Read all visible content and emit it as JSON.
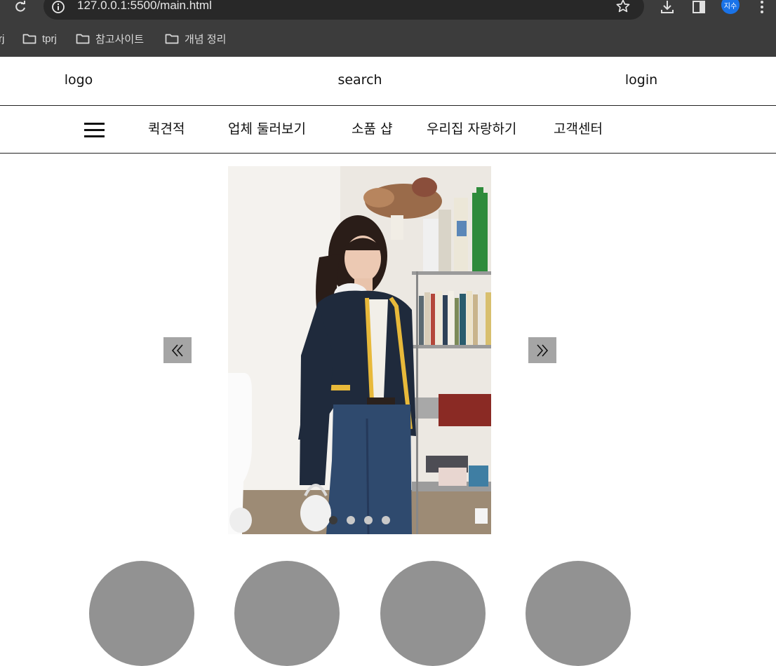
{
  "browser": {
    "url": "127.0.0.1:5500/main.html",
    "profile_initials": "지수",
    "bookmarks": [
      {
        "label": "rj"
      },
      {
        "label": "tprj"
      },
      {
        "label": "참고사이트"
      },
      {
        "label": "개념 정리"
      }
    ]
  },
  "header": {
    "logo": "logo",
    "search": "search",
    "login": "login"
  },
  "nav": {
    "items": [
      {
        "label": "퀵견적"
      },
      {
        "label": "업체 둘러보기"
      },
      {
        "label": "소품 샵"
      },
      {
        "label": "우리집 자랑하기"
      },
      {
        "label": "고객센터"
      }
    ]
  },
  "slider": {
    "prev_label": "«",
    "next_label": "»",
    "slide_count": 4,
    "active_index": 0
  },
  "colors": {
    "chrome_bg": "#3c3c3c",
    "arrow_bg": "#a5a5a5",
    "circle_bg": "#929292",
    "cardigan_trim": "#e8b93a"
  }
}
